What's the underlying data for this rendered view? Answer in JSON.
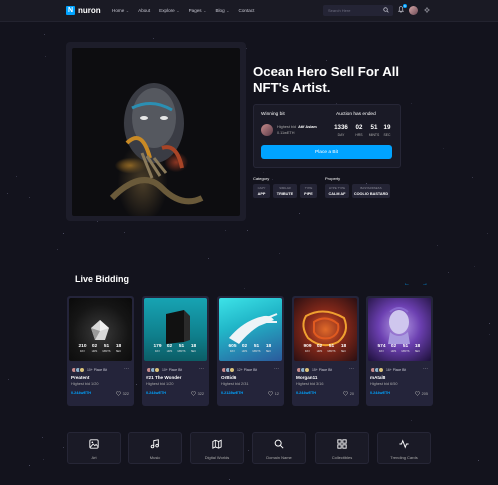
{
  "header": {
    "logo_mark": "N",
    "logo_text": "nuron",
    "nav": [
      {
        "label": "Home",
        "dropdown": true
      },
      {
        "label": "About",
        "dropdown": false
      },
      {
        "label": "Explore",
        "dropdown": true
      },
      {
        "label": "Pages",
        "dropdown": true
      },
      {
        "label": "Blog",
        "dropdown": true
      },
      {
        "label": "Contact",
        "dropdown": false
      }
    ],
    "search_placeholder": "Search Here",
    "notification_count": "6"
  },
  "hero": {
    "title": "Ocean Hero Sell For All NFT's Artist.",
    "winning_label": "Winning bit",
    "auction_label": "Auction has ended",
    "bidder_prefix": "Highest bid",
    "bidder_name": "Atif Aslam",
    "bidder_amount": "0.11wETH",
    "countdown": [
      {
        "value": "1336",
        "unit": "DAY"
      },
      {
        "value": "02",
        "unit": "HRS"
      },
      {
        "value": "51",
        "unit": "MINTS"
      },
      {
        "value": "19",
        "unit": "SEC"
      }
    ],
    "place_bid": "Place a Bit",
    "category_label": "Category",
    "property_label": "Property",
    "categories": [
      {
        "key": "CAPY",
        "value": "APP"
      },
      {
        "key": "SIMILAR",
        "value": "TRIBUTE"
      },
      {
        "key": "TYPE",
        "value": "PIPE"
      }
    ],
    "properties": [
      {
        "key": "HYPE TYPE",
        "value": "CALM AF"
      },
      {
        "key": "BASTARDNESS",
        "value": "COOLIO BASTARD"
      }
    ]
  },
  "live": {
    "title": "Live Bidding",
    "cards": [
      {
        "name": "Preatent",
        "owners_text": "10+ Place Bit",
        "bid": "Highest bid 1/20",
        "price": "0.244wETH",
        "likes": "322",
        "countdown": [
          "210",
          "02",
          "51",
          "18"
        ]
      },
      {
        "name": "#21 The Wonder",
        "owners_text": "10+ Place Bit",
        "bid": "Highest bid 1/20",
        "price": "0.244wETH",
        "likes": "322",
        "countdown": [
          "179",
          "02",
          "51",
          "18"
        ]
      },
      {
        "name": "OrBid6",
        "owners_text": "12+ Place Bit",
        "bid": "Highest bid 2/31",
        "price": "0.2128wETH",
        "likes": "12",
        "countdown": [
          "605",
          "02",
          "51",
          "18"
        ]
      },
      {
        "name": "Morgan11",
        "owners_text": "15+ Place Bit",
        "bid": "Highest bid 3/16",
        "price": "0.244wETH",
        "likes": "20",
        "countdown": [
          "909",
          "02",
          "51",
          "18"
        ]
      },
      {
        "name": "mAtal8",
        "owners_text": "16+ Place Bit",
        "bid": "Highest bid 6/50",
        "price": "0.244wETH",
        "likes": "205",
        "countdown": [
          "574",
          "02",
          "51",
          "18"
        ]
      }
    ],
    "units": [
      "DAY",
      "HRS",
      "MINTS",
      "SEC"
    ]
  },
  "category_tiles": [
    {
      "label": "Art",
      "icon": "image-icon"
    },
    {
      "label": "Music",
      "icon": "music-note-icon"
    },
    {
      "label": "Digital Worlds",
      "icon": "map-icon"
    },
    {
      "label": "Domain Name",
      "icon": "search-icon"
    },
    {
      "label": "Collectibles",
      "icon": "grid-icon"
    },
    {
      "label": "Trending Cards",
      "icon": "activity-icon"
    }
  ],
  "colors": {
    "accent": "#00a3ff",
    "background": "#13131d",
    "card": "#24243a"
  }
}
